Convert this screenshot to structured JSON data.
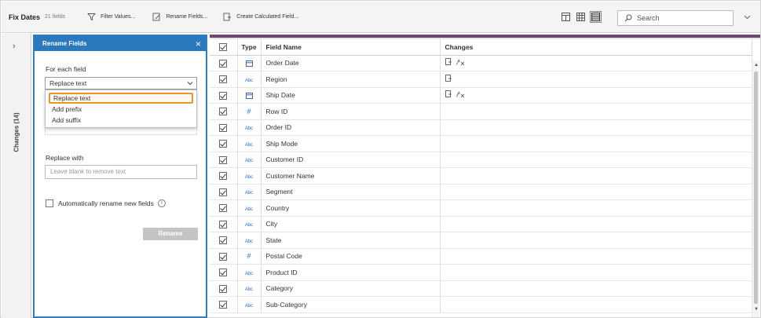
{
  "toolbar": {
    "title": "Fix Dates",
    "field_count": "21 fields",
    "filter_values": "Filter Values...",
    "rename_fields": "Rename Fields...",
    "create_calc": "Create Calculated Field...",
    "search_placeholder": "Search"
  },
  "changes_strip": {
    "label": "Changes (14)"
  },
  "rename_panel": {
    "title": "Rename Fields",
    "for_each_label": "For each field",
    "selected_option": "Replace text",
    "options": [
      "Replace text",
      "Add prefix",
      "Add suffix"
    ],
    "replace_with_label": "Replace with",
    "replace_with_placeholder": "Leave blank to remove text",
    "auto_rename_label": "Automatically rename new fields",
    "rename_button": "Rename"
  },
  "grid": {
    "columns": [
      "Type",
      "Field Name",
      "Changes"
    ],
    "rows": [
      {
        "type": "date",
        "name": "Order Date",
        "changes": [
          "rename",
          "calc"
        ]
      },
      {
        "type": "string",
        "name": "Region",
        "changes": [
          "rename"
        ]
      },
      {
        "type": "date",
        "name": "Ship Date",
        "changes": [
          "rename",
          "calc"
        ]
      },
      {
        "type": "number",
        "name": "Row ID",
        "changes": []
      },
      {
        "type": "string",
        "name": "Order ID",
        "changes": []
      },
      {
        "type": "string",
        "name": "Ship Mode",
        "changes": []
      },
      {
        "type": "string",
        "name": "Customer ID",
        "changes": []
      },
      {
        "type": "string",
        "name": "Customer Name",
        "changes": []
      },
      {
        "type": "string",
        "name": "Segment",
        "changes": []
      },
      {
        "type": "string",
        "name": "Country",
        "changes": []
      },
      {
        "type": "string",
        "name": "City",
        "changes": []
      },
      {
        "type": "string",
        "name": "State",
        "changes": []
      },
      {
        "type": "number",
        "name": "Postal Code",
        "changes": []
      },
      {
        "type": "string",
        "name": "Product ID",
        "changes": []
      },
      {
        "type": "string",
        "name": "Category",
        "changes": []
      },
      {
        "type": "string",
        "name": "Sub-Category",
        "changes": []
      }
    ],
    "type_glyphs": {
      "string": "Abc",
      "number": "#"
    }
  },
  "colors": {
    "accent_blue": "#2b78be",
    "highlight_orange": "#e8952a",
    "grid_topbar": "#6b4a74"
  }
}
